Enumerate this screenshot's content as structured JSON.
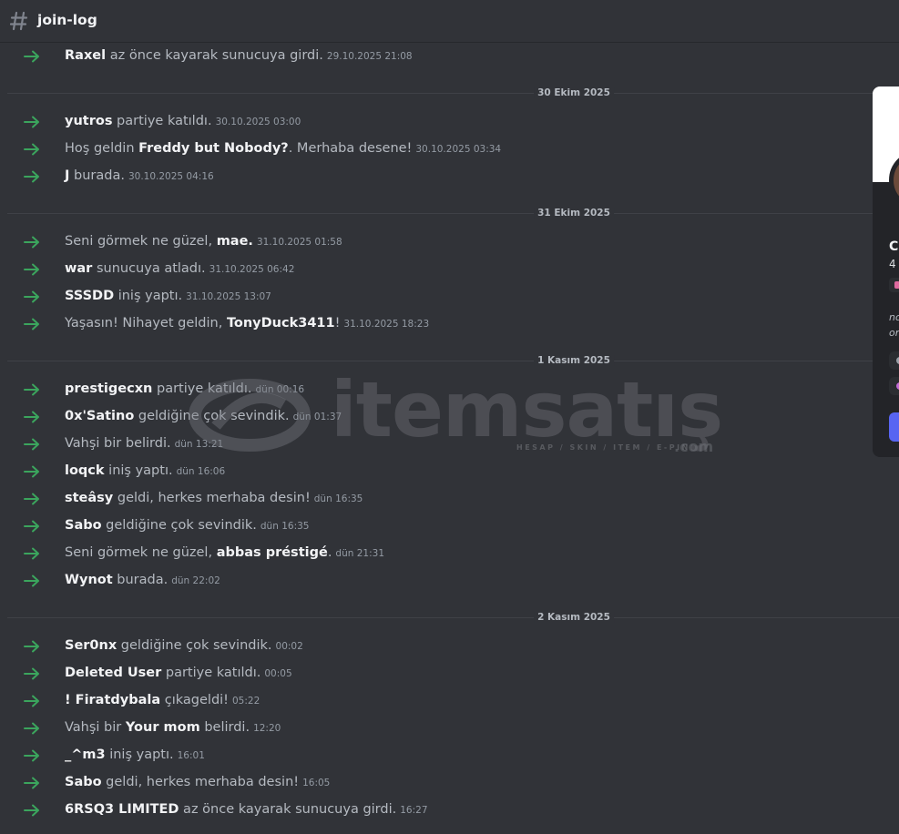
{
  "channel": {
    "name": "join-log",
    "icon": "hash-icon"
  },
  "colors": {
    "arrow": "#3ba55d",
    "background": "#313338",
    "username": "#f2f3f5"
  },
  "watermark": {
    "brand": "itemsatış",
    "tagline": "HESAP / SKIN / ITEM / E-PIN",
    "suffix": ".com"
  },
  "popout": {
    "name": "C",
    "subtitle": "4",
    "note": "no\nor"
  },
  "top_message": {
    "parts": [
      {
        "u": "Raxel"
      },
      {
        "t": " az önce kayarak sunucuya girdi."
      }
    ],
    "time": "29.10.2025 21:08"
  },
  "sections": [
    {
      "date": "30 Ekim 2025",
      "messages": [
        {
          "parts": [
            {
              "u": "yutros"
            },
            {
              "t": " partiye katıldı."
            }
          ],
          "time": "30.10.2025 03:00"
        },
        {
          "parts": [
            {
              "t": "Hoş geldin "
            },
            {
              "u": "Freddy but Nobody?"
            },
            {
              "t": ". Merhaba desene!"
            }
          ],
          "time": "30.10.2025 03:34"
        },
        {
          "parts": [
            {
              "u": "J"
            },
            {
              "t": " burada."
            }
          ],
          "time": "30.10.2025 04:16"
        }
      ]
    },
    {
      "date": "31 Ekim 2025",
      "messages": [
        {
          "parts": [
            {
              "t": "Seni görmek ne güzel, "
            },
            {
              "u": "mae."
            }
          ],
          "time": "31.10.2025 01:58"
        },
        {
          "parts": [
            {
              "u": "war"
            },
            {
              "t": " sunucuya atladı."
            }
          ],
          "time": "31.10.2025 06:42"
        },
        {
          "parts": [
            {
              "u": "SSSDD"
            },
            {
              "t": " iniş yaptı."
            }
          ],
          "time": "31.10.2025 13:07"
        },
        {
          "parts": [
            {
              "t": "Yaşasın! Nihayet geldin, "
            },
            {
              "u": "TonyDuck3411"
            },
            {
              "t": "!"
            }
          ],
          "time": "31.10.2025 18:23"
        }
      ]
    },
    {
      "date": "1 Kasım 2025",
      "messages": [
        {
          "parts": [
            {
              "u": "prestigecxn"
            },
            {
              "t": " partiye katıldı."
            }
          ],
          "time": "dün 00:16"
        },
        {
          "parts": [
            {
              "u": "0x'Satino"
            },
            {
              "t": " geldiğine çok sevindik."
            }
          ],
          "time": "dün 01:37"
        },
        {
          "parts": [
            {
              "t": "Vahşi bir "
            },
            {
              "dim": "      "
            },
            {
              "t": " belirdi."
            }
          ],
          "time": "dün 13:21"
        },
        {
          "parts": [
            {
              "u": "loqck"
            },
            {
              "t": " iniş yaptı."
            }
          ],
          "time": "dün 16:06"
        },
        {
          "parts": [
            {
              "u": "steâsy"
            },
            {
              "t": " geldi, herkes merhaba desin!"
            }
          ],
          "time": "dün 16:35"
        },
        {
          "parts": [
            {
              "u": "Sabo"
            },
            {
              "t": " geldiğine çok sevindik."
            }
          ],
          "time": "dün 16:35"
        },
        {
          "parts": [
            {
              "t": "Seni görmek ne güzel, "
            },
            {
              "u": "  abbas préstigé"
            },
            {
              "t": "."
            }
          ],
          "time": "dün 21:31"
        },
        {
          "parts": [
            {
              "u": "Wynot"
            },
            {
              "t": " burada."
            }
          ],
          "time": "dün 22:02"
        }
      ]
    },
    {
      "date": "2 Kasım 2025",
      "messages": [
        {
          "parts": [
            {
              "u": "Ser0nx"
            },
            {
              "t": " geldiğine çok sevindik."
            }
          ],
          "time": "00:02"
        },
        {
          "parts": [
            {
              "u": "Deleted User"
            },
            {
              "t": " partiye katıldı."
            }
          ],
          "time": "00:05"
        },
        {
          "parts": [
            {
              "u": "! Firatdybala"
            },
            {
              "t": " çıkageldi!"
            }
          ],
          "time": "05:22"
        },
        {
          "parts": [
            {
              "t": "Vahşi bir "
            },
            {
              "u": "Your mom"
            },
            {
              "t": " belirdi."
            }
          ],
          "time": "12:20"
        },
        {
          "parts": [
            {
              "u": "_^m3"
            },
            {
              "t": " iniş yaptı."
            }
          ],
          "time": "16:01"
        },
        {
          "parts": [
            {
              "u": "Sabo"
            },
            {
              "t": " geldi, herkes merhaba desin!"
            }
          ],
          "time": "16:05"
        },
        {
          "parts": [
            {
              "u": "6RSQ3 LIMITED"
            },
            {
              "t": " az önce kayarak sunucuya girdi."
            }
          ],
          "time": "16:27"
        }
      ]
    }
  ]
}
